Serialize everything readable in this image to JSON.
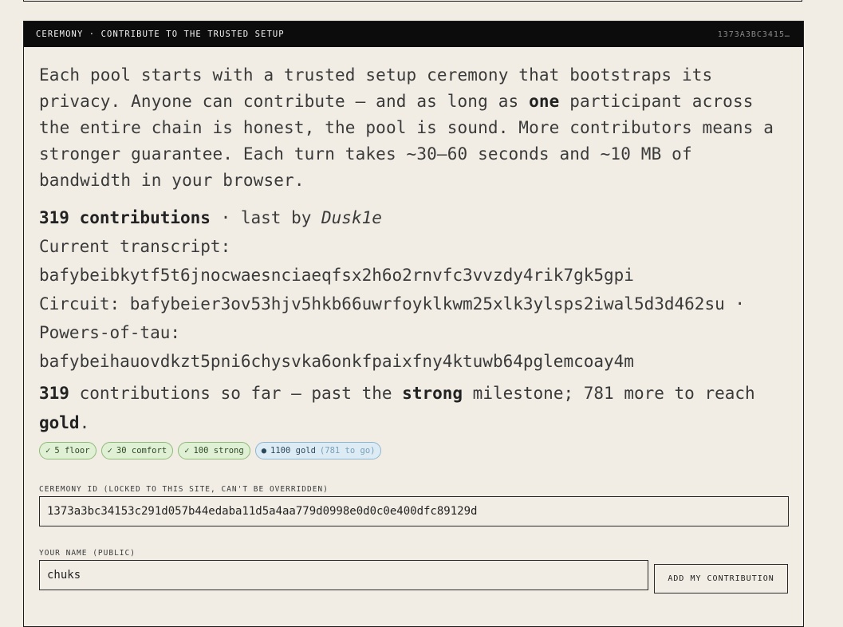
{
  "panel": {
    "title": "CEREMONY · CONTRIBUTE TO THE TRUSTED SETUP",
    "header_id": "1373A3BC3415…"
  },
  "intro": {
    "part1": "Each pool starts with a trusted setup ceremony that bootstraps its privacy. Anyone can contribute — and as long as ",
    "emphasis": "one",
    "part2": " participant across the entire chain is honest, the pool is sound. More contributors means a stronger guarantee. Each turn takes ~30–60 seconds and ~10 MB of bandwidth in your browser."
  },
  "stats": {
    "contributions": "319 contributions",
    "last_by_prefix": " · last by ",
    "last_by_name": "Dusk1e",
    "transcript_label": "Current transcript:",
    "transcript_cid": "bafybeibkytf5t6jnocwaesnciaeqfsx2h6o2rnvfc3vvzdy4rik7gk5gpi",
    "circuit_label": "Circuit: ",
    "circuit_cid": "bafybeier3ov53hjv5hkb66uwrfoyklkwm25xlk3ylsps2iwal5d3d462su",
    "circuit_sep": " ·",
    "pot_label": "Powers-of-tau:",
    "pot_cid": "bafybeihauovdkzt5pni6chysvka6onkfpaixfny4ktuwb64pglemcoay4m"
  },
  "milestone": {
    "count": "319",
    "text1": " contributions so far — past the ",
    "tier_passed": "strong",
    "text2": " milestone; 781 more to reach ",
    "tier_next": "gold",
    "end": "."
  },
  "badges": [
    {
      "icon": "✓",
      "label": "5 floor",
      "status": "done"
    },
    {
      "icon": "✓",
      "label": "30 comfort",
      "status": "done"
    },
    {
      "icon": "✓",
      "label": "100 strong",
      "status": "done"
    },
    {
      "icon": "●",
      "label": "1100 gold",
      "extra": "(781 to go)",
      "status": "pending"
    }
  ],
  "form": {
    "ceremony_id_label": "CEREMONY ID (LOCKED TO THIS SITE, CAN'T BE OVERRIDDEN)",
    "ceremony_id_value": "1373a3bc34153c291d057b44edaba11d5a4aa779d0998e0d0c0e400dfc89129d",
    "name_label": "YOUR NAME (PUBLIC)",
    "name_value": "chuks",
    "submit_label": "ADD MY CONTRIBUTION"
  },
  "colors": {
    "page_bg": "#f1ede5",
    "header_bg": "#0c0c0c",
    "badge_done_bg": "#dff0d4",
    "badge_pending_bg": "#dcebf4"
  }
}
